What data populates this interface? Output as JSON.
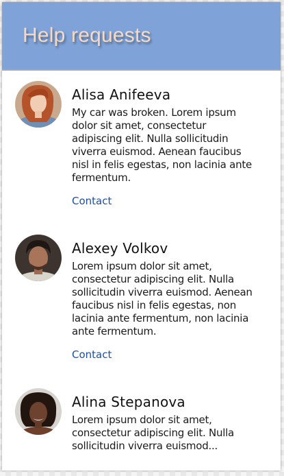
{
  "header": {
    "title": "Help requests",
    "bg_color": "#7fa3d9",
    "title_color": "#f6d9c3"
  },
  "requests": [
    {
      "name": "Alisa Anifeeva",
      "message": "My car was broken. Lorem ipsum dolor sit amet, consectetur adipiscing elit. Nulla sollicitudin viverra euismod. Aenean faucibus nisl in felis egestas, non lacinia ante fermentum.",
      "contact_label": "Contact"
    },
    {
      "name": "Alexey Volkov",
      "message": "Lorem ipsum dolor sit amet, consectetur adipiscing elit. Nulla sollicitudin viverra euismod. Aenean faucibus nisl in felis egestas, non lacinia ante fermentum, non lacinia ante fermentum.",
      "contact_label": "Contact"
    },
    {
      "name": "Alina Stepanova",
      "message": "Lorem ipsum dolor sit amet, consectetur adipiscing elit. Nulla sollicitudin viverra euismod...",
      "contact_label": ""
    }
  ],
  "link_color": "#1f4fa3"
}
